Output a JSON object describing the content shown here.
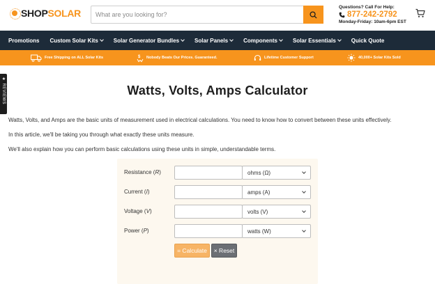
{
  "header": {
    "logo": {
      "shop": "SHOP",
      "solar": "SOLAR"
    },
    "search": {
      "placeholder": "What are you looking for?"
    },
    "contact": {
      "question": "Questions? Call For Help:",
      "phone": "877-242-2792",
      "hours": "Monday-Friday: 10am-6pm EST"
    }
  },
  "nav": {
    "items": [
      {
        "label": "Promotions",
        "has_dropdown": false
      },
      {
        "label": "Custom Solar Kits",
        "has_dropdown": true
      },
      {
        "label": "Solar Generator Bundles",
        "has_dropdown": true
      },
      {
        "label": "Solar Panels",
        "has_dropdown": true
      },
      {
        "label": "Components",
        "has_dropdown": true
      },
      {
        "label": "Solar Essentials",
        "has_dropdown": true
      },
      {
        "label": "Quick Quote",
        "has_dropdown": false
      }
    ]
  },
  "promo": {
    "items": [
      {
        "label": "Free Shipping on ALL Solar Kits",
        "icon": "truck-icon"
      },
      {
        "label": "Nobody Beats Our Prices. Guaranteed.",
        "icon": "price-tag-icon"
      },
      {
        "label": "Lifetime Customer Support",
        "icon": "headset-icon"
      },
      {
        "label": "40,000+ Solar Kits Sold",
        "icon": "sun-icon"
      }
    ]
  },
  "reviews_tab": {
    "star": "★",
    "label": "REVIEWS"
  },
  "page": {
    "title": "Watts, Volts, Amps Calculator",
    "paragraphs": [
      "Watts, Volts, and Amps are the basic units of measurement used in electrical calculations. You need to know how to convert between these units effectively.",
      "In this article, we'll be taking you through what exactly these units measure.",
      "We'll also explain how you can perform basic calculations using these units in simple, understandable terms."
    ]
  },
  "calculator": {
    "rows": [
      {
        "label": "Resistance",
        "symbol": "R",
        "value": "",
        "unit": "ohms (Ω)"
      },
      {
        "label": "Current",
        "symbol": "I",
        "value": "",
        "unit": "amps (A)"
      },
      {
        "label": "Voltage",
        "symbol": "V",
        "value": "",
        "unit": "volts (V)"
      },
      {
        "label": "Power",
        "symbol": "P",
        "value": "",
        "unit": "watts (W)"
      }
    ],
    "calculate_label": "= Calculate",
    "reset_label": "× Reset"
  },
  "colors": {
    "accent": "#f7941d",
    "nav_bg": "#1d2b39",
    "calc_bg": "#fdf8ef"
  }
}
